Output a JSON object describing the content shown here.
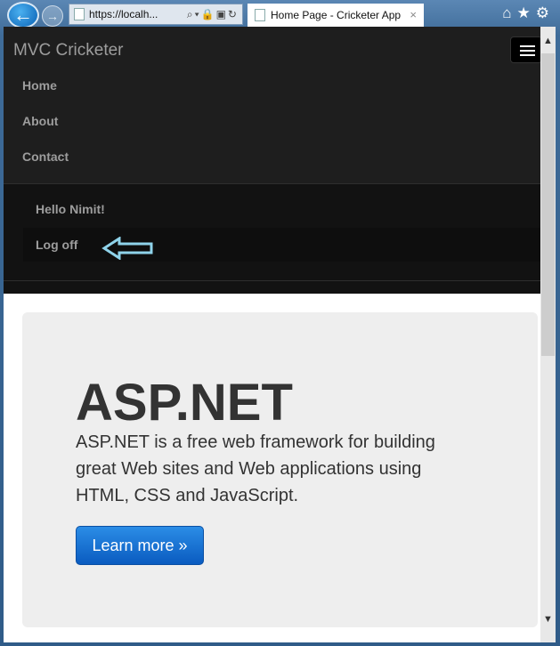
{
  "browser": {
    "address": "https://localh...",
    "tab_title": "Home Page - Cricketer App",
    "tab_close": "×",
    "address_icons": "⌕▾🔒▣↻",
    "back": "←",
    "forward": "→",
    "tools": "⌂★⚙"
  },
  "navbar": {
    "brand": "MVC Cricketer",
    "items": [
      {
        "label": "Home"
      },
      {
        "label": "About"
      },
      {
        "label": "Contact"
      }
    ],
    "greeting": "Hello Nimit!",
    "logoff": "Log off"
  },
  "jumbotron": {
    "title": "ASP.NET",
    "lead": "ASP.NET is a free web framework for building great Web sites and Web applications using HTML, CSS and JavaScript.",
    "button": "Learn more »"
  },
  "colors": {
    "annotation_arrow": "#8fd3ea",
    "button": "#0a62c8"
  }
}
